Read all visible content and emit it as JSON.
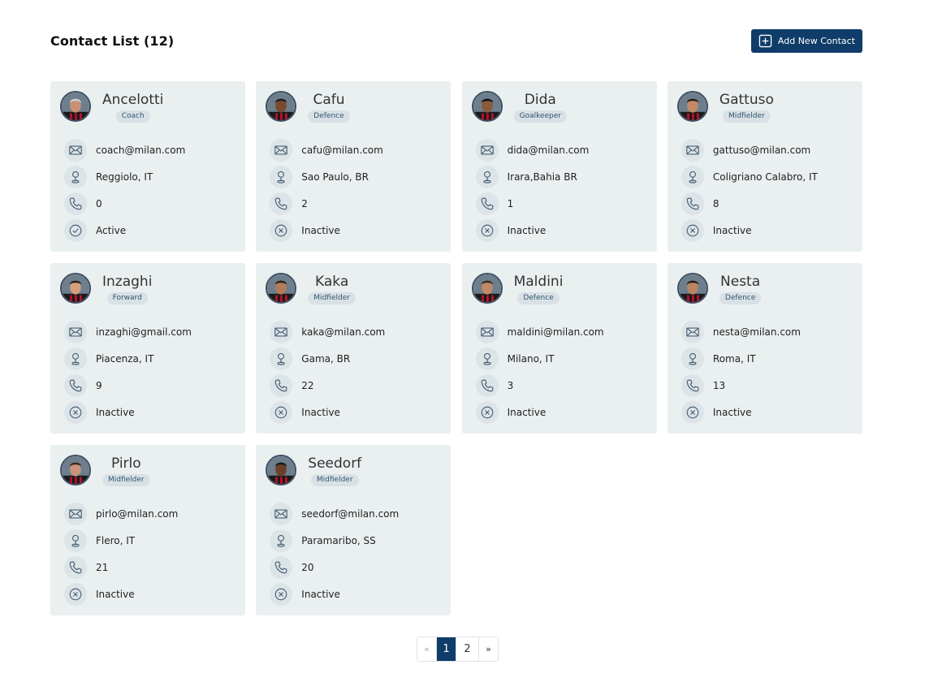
{
  "header": {
    "title": "Contact List (12)",
    "add_button_label": "Add New Contact"
  },
  "contacts": [
    {
      "name": "Ancelotti",
      "role": "Coach",
      "email": "coach@milan.com",
      "location": "Reggiolo, IT",
      "phone": "0",
      "status": "Active",
      "active": true
    },
    {
      "name": "Cafu",
      "role": "Defence",
      "email": "cafu@milan.com",
      "location": "Sao Paulo, BR",
      "phone": "2",
      "status": "Inactive",
      "active": false
    },
    {
      "name": "Dida",
      "role": "Goalkeeper",
      "email": "dida@milan.com",
      "location": "Irara,Bahia BR",
      "phone": "1",
      "status": "Inactive",
      "active": false
    },
    {
      "name": "Gattuso",
      "role": "Midfielder",
      "email": "gattuso@milan.com",
      "location": "Coligriano Calabro, IT",
      "phone": "8",
      "status": "Inactive",
      "active": false
    },
    {
      "name": "Inzaghi",
      "role": "Forward",
      "email": "inzaghi@gmail.com",
      "location": "Piacenza, IT",
      "phone": "9",
      "status": "Inactive",
      "active": false
    },
    {
      "name": "Kaka",
      "role": "Midfielder",
      "email": "kaka@milan.com",
      "location": "Gama, BR",
      "phone": "22",
      "status": "Inactive",
      "active": false
    },
    {
      "name": "Maldini",
      "role": "Defence",
      "email": "maldini@milan.com",
      "location": "Milano, IT",
      "phone": "3",
      "status": "Inactive",
      "active": false
    },
    {
      "name": "Nesta",
      "role": "Defence",
      "email": "nesta@milan.com",
      "location": "Roma, IT",
      "phone": "13",
      "status": "Inactive",
      "active": false
    },
    {
      "name": "Pirlo",
      "role": "Midfielder",
      "email": "pirlo@milan.com",
      "location": "Flero, IT",
      "phone": "21",
      "status": "Inactive",
      "active": false
    },
    {
      "name": "Seedorf",
      "role": "Midfielder",
      "email": "seedorf@milan.com",
      "location": "Paramaribo, SS",
      "phone": "20",
      "status": "Inactive",
      "active": false
    }
  ],
  "icons": {
    "email": "envelope-icon",
    "location": "map-pin-icon",
    "phone": "phone-icon",
    "active": "check-circle-icon",
    "inactive": "x-circle-icon",
    "add": "plus-square-icon"
  },
  "colors": {
    "accent": "#0f3c68",
    "card_bg": "#eaeff0",
    "icon_stroke": "#4a6275"
  },
  "pagination": {
    "prev": "«",
    "pages": [
      "1",
      "2"
    ],
    "current": "1",
    "next": "»"
  }
}
